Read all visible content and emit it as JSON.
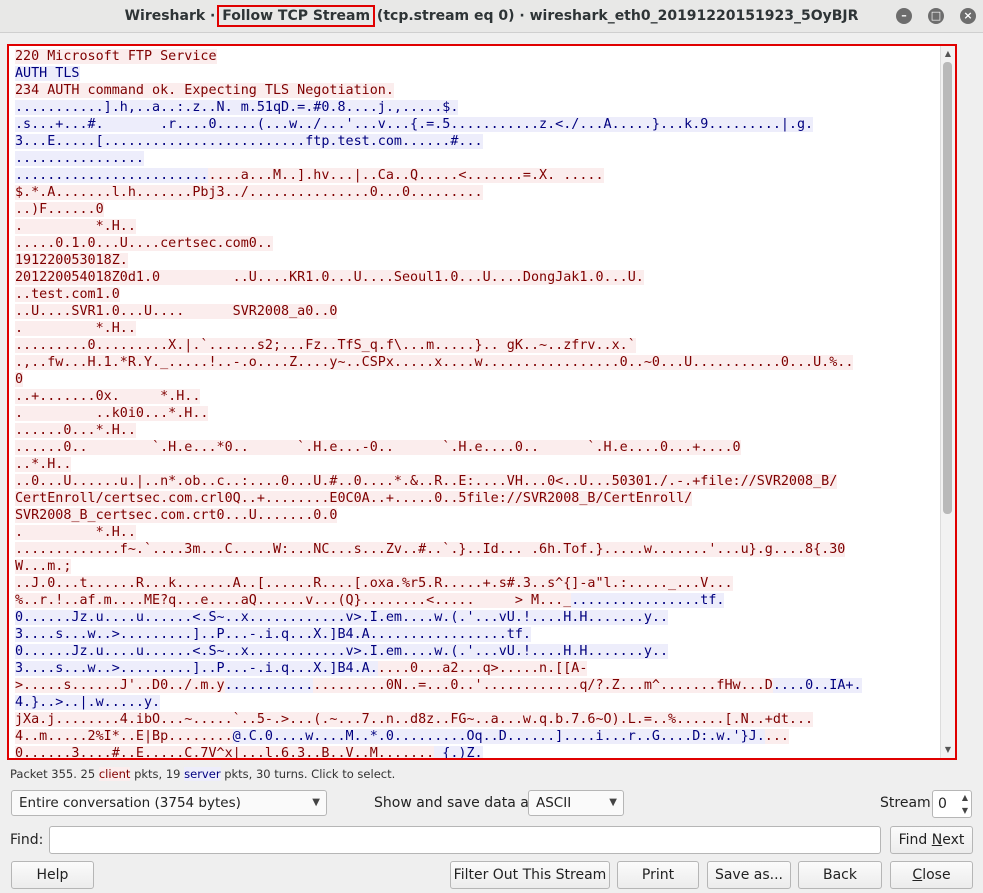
{
  "window": {
    "title_prefix": "Wireshark · ",
    "title_highlight": "Follow TCP Stream",
    "title_suffix": " (tcp.stream eq 0) · wireshark_eth0_20191220151923_5OyBJR"
  },
  "stream_lines": [
    {
      "t": "c",
      "text": "220 Microsoft FTP Service"
    },
    {
      "t": "s",
      "text": "AUTH TLS"
    },
    {
      "t": "c",
      "text": "234 AUTH command ok. Expecting TLS Negotiation."
    },
    {
      "t": "s",
      "text": "...........].h,..a..:.z..N. m.51qD.=.#0.8....j.,.....$."
    },
    {
      "t": "s",
      "text": ".s...+...#.       .r....0.....(...w../...'...v...{.=.5...........z.<./...A.....}...k.9.........|.g."
    },
    {
      "t": "s",
      "text": "3...E.....[.........................ftp.test.com......#..."
    },
    {
      "t": "s",
      "text": "................"
    },
    {
      "t": "s",
      "text": "........................",
      "c": "....a...M..].hv...|..Ca..Q.....<.......=.X. ....."
    },
    {
      "t": "c",
      "text": "$.*.A.......l.h.......Pbj3../...............0...0........."
    },
    {
      "t": "c",
      "text": "..)F......0"
    },
    {
      "t": "c",
      "text": ".         *.H.."
    },
    {
      "t": "c",
      "text": ".....0.1.0...U....certsec.com0.."
    },
    {
      "t": "c",
      "text": "191220053018Z."
    },
    {
      "t": "c",
      "text": "201220054018Z0d1.0         ..U....KR1.0...U....Seoul1.0...U....DongJak1.0...U."
    },
    {
      "t": "c",
      "text": "..test.com1.0"
    },
    {
      "t": "c",
      "text": "..U....SVR1.0...U....      SVR2008_a0..0"
    },
    {
      "t": "c",
      "text": ".         *.H.."
    },
    {
      "t": "c",
      "text": ".........0.........X.|.`......s2;...Fz..TfS_q.f\\...m.....}.. gK..~..zfrv..x.`"
    },
    {
      "t": "c",
      "text": ".,..fw...H.1.*R.Y._.....!..-.o....Z....y~..CSPx.....x....w.................0..~0...U...........0...U.%.."
    },
    {
      "t": "c",
      "text": "0"
    },
    {
      "t": "c",
      "text": "..+.......0x.     *.H.."
    },
    {
      "t": "c",
      "text": ".         ..k0i0...*.H.."
    },
    {
      "t": "c",
      "text": "......0...*.H.."
    },
    {
      "t": "c",
      "text": "......0..        `.H.e...*0..      `.H.e...-0..      `.H.e....0..      `.H.e....0...+....0"
    },
    {
      "t": "c",
      "text": "..*.H.."
    },
    {
      "t": "c",
      "text": "..0...U......u.|..n*.ob..c..:....0...U.#..0....*.&..R..E:....VH...0<..U...50301./.-.+file://SVR2008_B/"
    },
    {
      "t": "c",
      "text": "CertEnroll/certsec.com.crl0Q..+........E0C0A..+.....0..5file://SVR2008_B/CertEnroll/"
    },
    {
      "t": "c",
      "text": "SVR2008_B_certsec.com.crt0...U.......0.0"
    },
    {
      "t": "c",
      "text": ".         *.H.."
    },
    {
      "t": "c",
      "text": ".............f~.`....3m...C.....W:...NC...s...Zv..#..`.}..Id... .6h.Tof.}.....w.......'...u}.g....8{.30"
    },
    {
      "t": "c",
      "text": "W...m.;"
    },
    {
      "t": "c",
      "text": "..J.0...t......R...k.......A..[......R....[.oxa.%r5.R.....+.s#.3..s^{]-a\"l.:....._...V..."
    },
    {
      "t": "c",
      "text": "%..r.!..af.m....ME?q...e....aQ......v...(Q}........<.....     > M..._",
      "s": "................tf."
    },
    {
      "t": "s",
      "text": "0......Jz.u....u......<.S~..x............v>.I.em....w.(.'...vU.!....H.H.......y.."
    },
    {
      "t": "s",
      "text": "3....s...w..>.........]..P...-.i.q...X.]B4.A.................tf."
    },
    {
      "t": "s",
      "text": "0......Jz.u....u......<.S~..x............v>.I.em....w.(.'...vU.!....H.H.......y.."
    },
    {
      "t": "s",
      "text": "3....s...w..>.........]..P...-.i.q...X.]B4.A.",
      "c": "....0...a2...q>.....n.[[A-"
    },
    {
      "t": "c",
      "text": ">.....s......J'..D0../.m.y",
      "s": "...........",
      "c2": ".........0N..=...0..'............q/?.Z...m^.......fHw...D",
      "s2": "....0..IA+."
    },
    {
      "t": "s",
      "text": "4.}..>..|.w.....y."
    },
    {
      "t": "c",
      "text": "jXa.j........4.ibO...~.....`..5-.>...(.~...7..n..d8z..FG~..a...w.q.b.7.6~O).L.=..%......[.N..+dt..."
    },
    {
      "t": "c",
      "text": "4..m.....2%I*..E|Bp........",
      "s": "@.C.0....w....M..*.0.........Oq..D......]....i...r..G....D:.w.'}J.",
      "c2": "..."
    },
    {
      "t": "c",
      "text": "0......3....#..E.....C.7V^x|...l.6.3..B..V..M.......",
      "s": " {.)Z."
    }
  ],
  "packet_info": {
    "prefix": "Packet 355. 25 ",
    "client": "client",
    "middle": " pkts, 19 ",
    "server": "server",
    "suffix": " pkts, 30 turns. Click to select."
  },
  "controls": {
    "conversation_select": "Entire conversation (3754 bytes)",
    "show_as_label": "Show and save data as",
    "show_as_value": "ASCII",
    "stream_label": "Stream",
    "stream_value": "0",
    "find_label": "Find:",
    "find_value": "",
    "find_next_pre": "Find ",
    "find_next_ul": "N",
    "find_next_post": "ext"
  },
  "buttons": {
    "help": "Help",
    "filter_out": "Filter Out This Stream",
    "print": "Print",
    "save_as": "Save as...",
    "back": "Back",
    "close_ul": "C",
    "close_rest": "lose"
  },
  "colors": {
    "client_fg": "#7f0000",
    "client_bg": "#fbeded",
    "server_fg": "#00007f",
    "server_bg": "#ededfb",
    "highlight_border": "#e00000"
  }
}
